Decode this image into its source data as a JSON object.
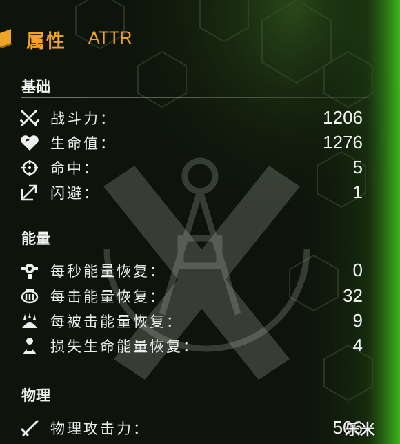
{
  "header": {
    "title_zh": "属性",
    "title_en": "ATTR"
  },
  "sections": [
    {
      "title": "基础",
      "rows": [
        {
          "icon": "crossed-swords-icon",
          "label": "战斗力：",
          "value": "1206"
        },
        {
          "icon": "heart-icon",
          "label": "生命值：",
          "value": "1276"
        },
        {
          "icon": "crosshair-icon",
          "label": "命中：",
          "value": "5"
        },
        {
          "icon": "dodge-arrow-icon",
          "label": "闪避：",
          "value": "1"
        }
      ]
    },
    {
      "title": "能量",
      "rows": [
        {
          "icon": "energy-per-second-icon",
          "label": "每秒能量恢复：",
          "value": "0"
        },
        {
          "icon": "energy-per-hit-icon",
          "label": "每击能量恢复：",
          "value": "32"
        },
        {
          "icon": "energy-when-hit-icon",
          "label": "每被击能量恢复：",
          "value": "9"
        },
        {
          "icon": "energy-on-hp-loss-icon",
          "label": "损失生命能量恢复：",
          "value": "4"
        }
      ]
    },
    {
      "title": "物理",
      "rows": [
        {
          "icon": "sword-icon",
          "label": "物理攻击力：",
          "value": "506"
        }
      ]
    }
  ],
  "watermark": "乐米",
  "colors": {
    "accent": "#f0a526",
    "background": "#0c1209",
    "glow": "#3fbf1c"
  }
}
